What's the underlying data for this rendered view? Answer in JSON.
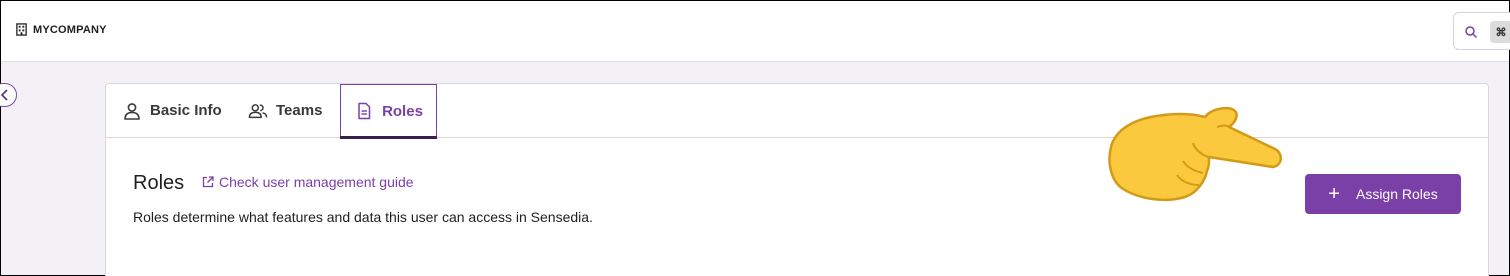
{
  "header": {
    "company": "MYCOMPANY",
    "search_shortcut": "⌘"
  },
  "tabs": [
    {
      "label": "Basic Info",
      "icon": "person-icon"
    },
    {
      "label": "Teams",
      "icon": "people-icon"
    },
    {
      "label": "Roles",
      "icon": "document-icon",
      "active": true
    }
  ],
  "roles_section": {
    "title": "Roles",
    "guide_link": "Check user management guide",
    "description": "Roles determine what features and data this user can access in Sensedia.",
    "assign_button": "Assign Roles",
    "assign_icon": "+"
  },
  "colors": {
    "accent": "#7b3fa8",
    "background": "#f3f1f6",
    "pointer": "#fbc93d"
  }
}
